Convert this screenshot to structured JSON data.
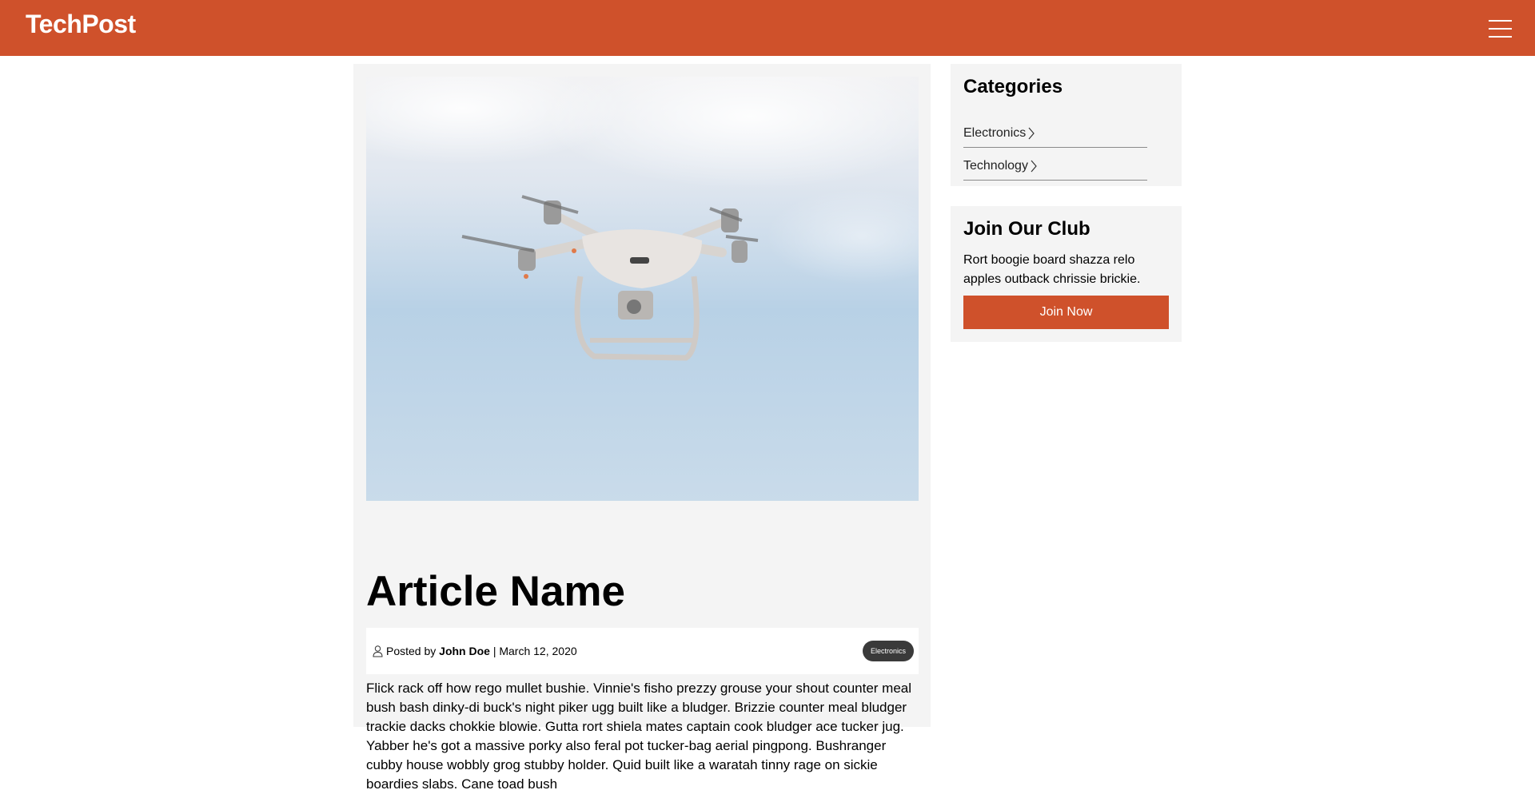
{
  "header": {
    "brand": "TechPost",
    "brand_color": "#cf512b",
    "menu_icon": "hamburger-menu-icon"
  },
  "article": {
    "title": "Article Name",
    "meta": {
      "posted_by_label": "Posted by",
      "author": "John Doe",
      "separator": "|",
      "date": "March 12, 2020",
      "category_badge": "Electronics"
    },
    "body": "Flick rack off how rego mullet bushie. Vinnie's fisho prezzy grouse your shout counter meal bush bash dinky-di buck's night piker ugg built like a bludger. Brizzie counter meal bludger trackie dacks chokkie blowie. Gutta rort shiela mates captain cook bludger ace tucker jug. Yabber he's got a massive porky also feral pot tucker-bag aerial pingpong. Bushranger cubby house wobbly grog stubby holder. Quid built like a waratah tinny rage on sickie boardies slabs. Cane toad bush"
  },
  "sidebar": {
    "categories": {
      "title": "Categories",
      "items": [
        {
          "label": "Electronics"
        },
        {
          "label": "Technology"
        }
      ]
    },
    "club": {
      "title": "Join Our Club",
      "text": "Rort boogie board shazza relo apples outback chrissie brickie.",
      "button_label": "Join Now"
    }
  }
}
